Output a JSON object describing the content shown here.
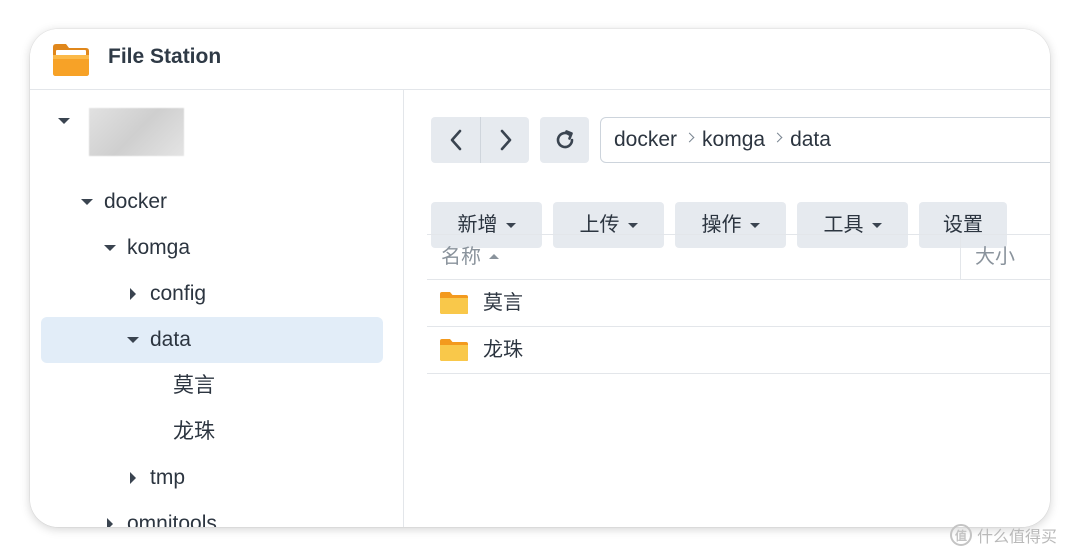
{
  "app": {
    "title": "File Station",
    "icon": "folder-app-icon"
  },
  "sidebar": {
    "items": [
      {
        "label": "",
        "level": 0,
        "expanded": true,
        "blurred": true
      },
      {
        "label": "docker",
        "level": 1,
        "expanded": true
      },
      {
        "label": "komga",
        "level": 2,
        "expanded": true
      },
      {
        "label": "config",
        "level": 3,
        "expanded": false
      },
      {
        "label": "data",
        "level": 3,
        "expanded": true,
        "selected": true
      },
      {
        "label": "莫言",
        "level": 4
      },
      {
        "label": "龙珠",
        "level": 4
      },
      {
        "label": "tmp",
        "level": 3,
        "expanded": false
      },
      {
        "label": "omnitools",
        "level": 2,
        "expanded": false
      }
    ]
  },
  "toolbar": {
    "back_icon": "chevron-left-icon",
    "forward_icon": "chevron-right-icon",
    "refresh_icon": "refresh-icon",
    "path": [
      "docker",
      "komga",
      "data"
    ],
    "buttons": {
      "create": "新增",
      "upload": "上传",
      "action": "操作",
      "tools": "工具",
      "settings": "设置"
    }
  },
  "grid": {
    "columns": {
      "name": "名称",
      "size": "大小"
    },
    "rows": [
      {
        "name": "莫言",
        "icon": "folder-icon"
      },
      {
        "name": "龙珠",
        "icon": "folder-icon"
      }
    ]
  },
  "watermark": {
    "text": "什么值得买",
    "icon_glyph": "值"
  },
  "colors": {
    "selected_row": "#e2edf8",
    "button_bg": "#e6eaef",
    "folder_yellow": "#f7c948",
    "folder_orange": "#f39a1e"
  }
}
